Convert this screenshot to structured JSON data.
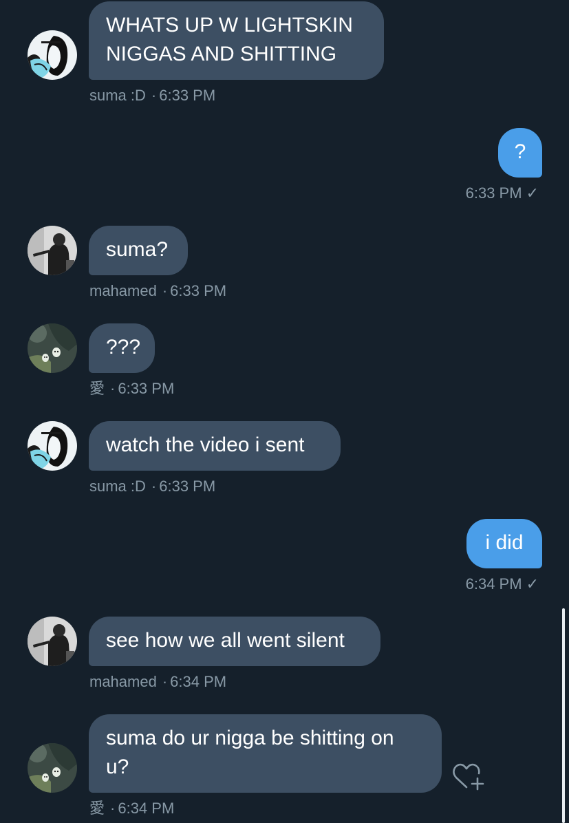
{
  "colors": {
    "background": "#15202b",
    "incoming_bubble": "#3d4f63",
    "outgoing_bubble": "#4a9ee9",
    "meta_text": "#8899a6"
  },
  "messages": [
    {
      "direction": "in",
      "avatar": "anime-girl-avatar",
      "sender": "suma :D",
      "time": "6:33 PM",
      "lines": [
        "WHATS UP W LIGHTSKIN",
        "NIGGAS AND SHITTING"
      ]
    },
    {
      "direction": "out",
      "text": "?",
      "time": "6:33 PM",
      "status_icon": "check-icon",
      "status": "✓"
    },
    {
      "direction": "in",
      "avatar": "bw-photo-avatar",
      "sender": "mahamed",
      "time": "6:33 PM",
      "text": "suma?"
    },
    {
      "direction": "in",
      "avatar": "forest-spirit-avatar",
      "sender": "愛",
      "time": "6:33 PM",
      "text": "???"
    },
    {
      "direction": "in",
      "avatar": "anime-girl-avatar",
      "sender": "suma :D",
      "time": "6:33 PM",
      "text": "watch the video i sent"
    },
    {
      "direction": "out",
      "text": "i did",
      "time": "6:34 PM",
      "status_icon": "check-icon",
      "status": "✓"
    },
    {
      "direction": "in",
      "avatar": "bw-photo-avatar",
      "sender": "mahamed",
      "time": "6:34 PM",
      "text": "see how we all went silent"
    },
    {
      "direction": "in",
      "avatar": "forest-spirit-avatar",
      "sender": "愛",
      "time": "6:34 PM",
      "lines": [
        "suma do ur nigga be shitting on",
        "u?"
      ],
      "reaction_icon": "add-reaction-heart-icon"
    }
  ],
  "meta_separator": "·"
}
